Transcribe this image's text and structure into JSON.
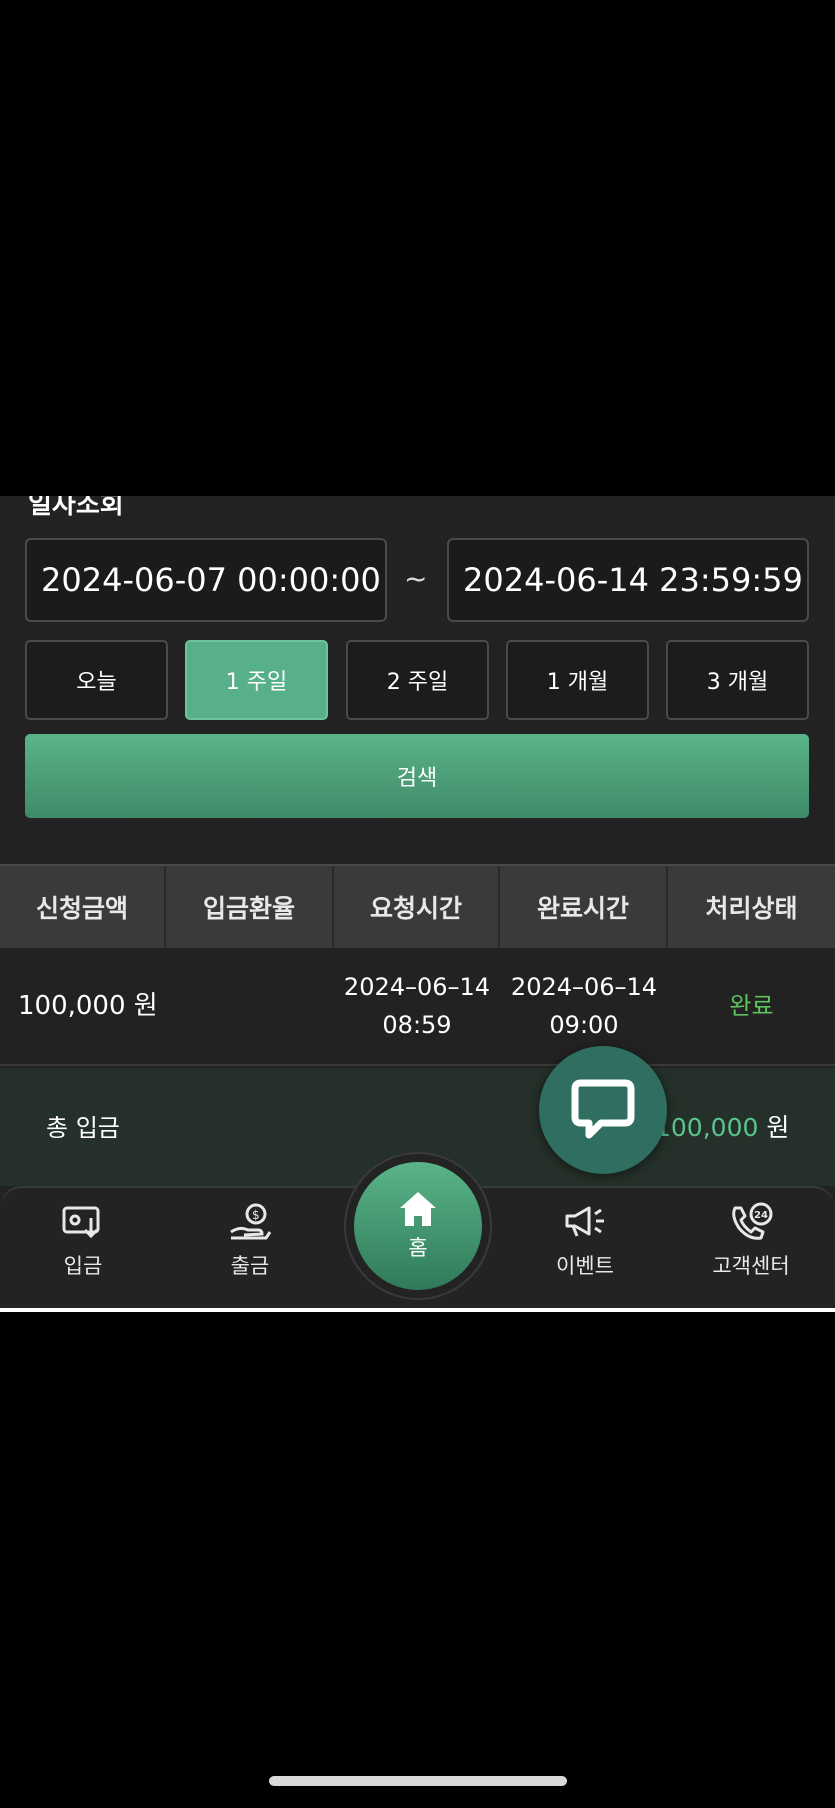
{
  "section_title": "일자조회",
  "date_range": {
    "from": "2024-06-07 00:00:00",
    "separator": "~",
    "to": "2024-06-14 23:59:59"
  },
  "period_buttons": [
    {
      "label": "오늘",
      "active": false
    },
    {
      "label": "1 주일",
      "active": true
    },
    {
      "label": "2 주일",
      "active": false
    },
    {
      "label": "1 개월",
      "active": false
    },
    {
      "label": "3 개월",
      "active": false
    }
  ],
  "search_label": "검색",
  "table": {
    "headers": [
      "신청금액",
      "입금환율",
      "요청시간",
      "완료시간",
      "처리상태"
    ],
    "rows": [
      {
        "amount": "100,000 원",
        "rate": "",
        "request_date": "2024–06–14",
        "request_time": "08:59",
        "complete_date": "2024–06–14",
        "complete_time": "09:00",
        "status": "완료"
      }
    ]
  },
  "total": {
    "label": "총 입금",
    "amount": "100,000",
    "unit": " 원"
  },
  "nav": {
    "deposit": "입금",
    "withdraw": "출금",
    "home": "홈",
    "event": "이벤트",
    "support": "고객센터"
  },
  "colors": {
    "accent": "#58b08a",
    "status_complete": "#5cc35a",
    "chat_fab": "#2f6e60"
  }
}
